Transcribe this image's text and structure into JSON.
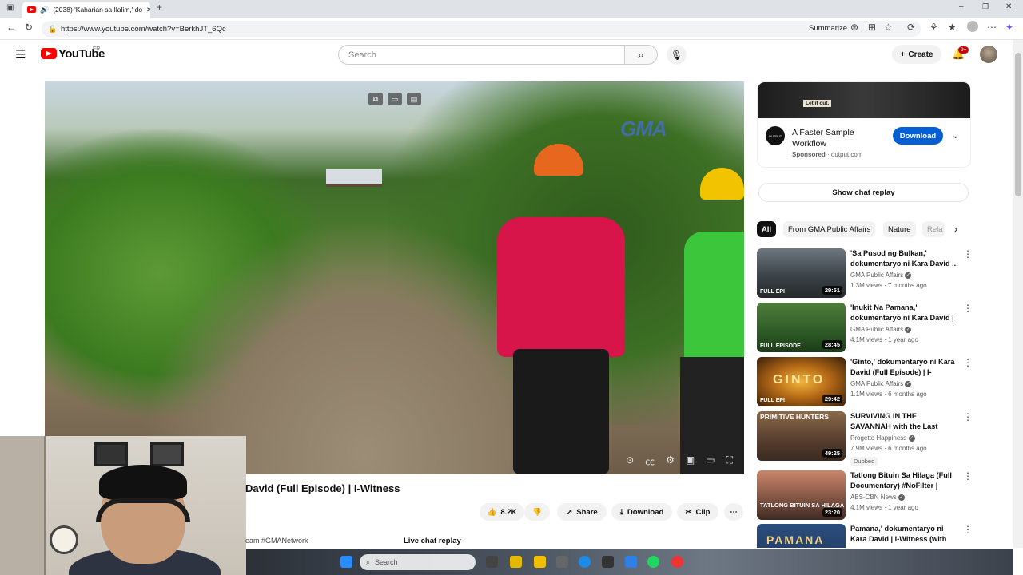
{
  "browser": {
    "tab_title": "(2038) 'Kaharian sa Ilalim,' do",
    "url": "https://www.youtube.com/watch?v=BerkhJT_6Qc",
    "summarize_label": "Summarize"
  },
  "header": {
    "logo_text": "YouTube",
    "region": "FR",
    "search_placeholder": "Search",
    "create_label": "Create",
    "notif_count": "9+"
  },
  "video": {
    "watermark": "GMA",
    "title": "David (Full Episode) | I-Witness",
    "likes": "8.2K",
    "share_label": "Share",
    "download_label": "Download",
    "clip_label": "Clip",
    "description_fragment": "eam #GMANetwork",
    "live_chat_label": "Live chat replay"
  },
  "ad": {
    "banner_text": "Let it out.",
    "title": "A Faster Sample Workflow",
    "sponsored": "Sponsored",
    "domain": "output.com",
    "download_label": "Download"
  },
  "chat_replay_label": "Show chat replay",
  "chips": [
    "All",
    "From GMA Public Affairs",
    "Nature",
    "Rela"
  ],
  "recommendations": [
    {
      "title": "'Sa Pusod ng Bulkan,' dokumentaryo ni Kara David ...",
      "channel": "GMA Public Affairs",
      "meta": "1.3M views · 7 months ago",
      "duration": "29:51",
      "label": "FULL EPI",
      "thumb_text": "",
      "tag": ""
    },
    {
      "title": "'Inukit Na Pamana,' dokumentaryo ni Kara David | I...",
      "channel": "GMA Public Affairs",
      "meta": "4.1M views · 1 year ago",
      "duration": "28:45",
      "label": "FULL EPISODE",
      "thumb_text": "",
      "tag": ""
    },
    {
      "title": "'Ginto,' dokumentaryo ni Kara David (Full Episode) | I-Witness",
      "channel": "GMA Public Affairs",
      "meta": "1.1M views · 6 months ago",
      "duration": "29:42",
      "label": "FULL EPI",
      "thumb_text": "GINTO",
      "tag": ""
    },
    {
      "title": "SURVIVING IN THE SAVANNAH with the Last Stone Age Men",
      "channel": "Progetto Happiness",
      "meta": "7.9M views · 6 months ago",
      "duration": "49:25",
      "label": "",
      "thumb_text": "PRIMITIVE HUNTERS",
      "tag": "Dubbed"
    },
    {
      "title": "Tatlong Bituin Sa Hilaga (Full Documentary) #NoFilter | ABS...",
      "channel": "ABS-CBN News",
      "meta": "4.1M views · 1 year ago",
      "duration": "23:20",
      "label": "TATLONG BITUIN SA HILAGA",
      "thumb_text": "",
      "tag": ""
    },
    {
      "title": "Pamana,' dokumentaryo ni Kara David | I-Witness (with English ...",
      "channel": "",
      "meta": "",
      "duration": "",
      "label": "",
      "thumb_text": "PAMANA",
      "tag": ""
    }
  ],
  "taskbar": {
    "search_label": "Search"
  },
  "colors": {
    "accent": "#065fd4",
    "brand_red": "#ff0000"
  }
}
